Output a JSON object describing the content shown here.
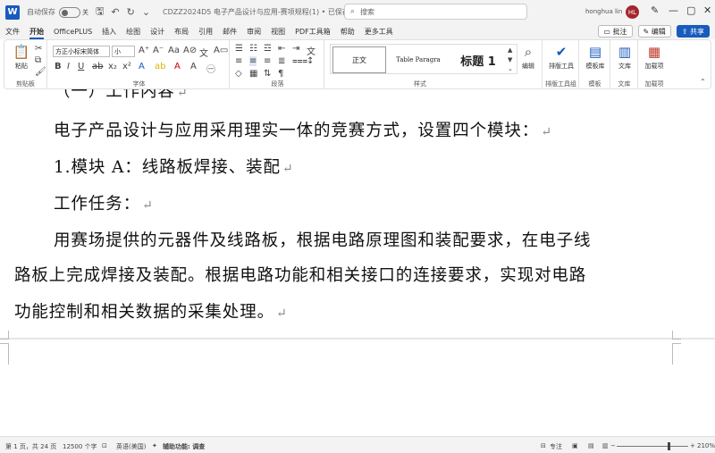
{
  "titlebar": {
    "app_icon": "W",
    "autosave_label": "自动保存",
    "autosave_state": "关",
    "doc_title": "CDZZ2024D5 电子产品设计与应用-赛项规程(1) • 已保存",
    "search_placeholder": "搜索",
    "user_name": "honghua lin",
    "user_initials": "HL"
  },
  "menu": {
    "tabs": [
      "文件",
      "开始",
      "OfficePLUS",
      "插入",
      "绘图",
      "设计",
      "布局",
      "引用",
      "邮件",
      "审阅",
      "视图",
      "PDF工具箱",
      "帮助",
      "更多工具"
    ],
    "active_index": 1,
    "comment_btn": "批注",
    "edit_btn": "编辑",
    "share_btn": "共享"
  },
  "ribbon": {
    "clipboard": {
      "label": "剪贴板",
      "paste": "粘贴"
    },
    "font": {
      "label": "字体",
      "font_name": "方正小标宋简体",
      "font_size": "小"
    },
    "paragraph": {
      "label": "段落"
    },
    "styles": {
      "label": "样式",
      "items": [
        "正文",
        "Table Paragra",
        "标题 1"
      ]
    },
    "editing": {
      "find": "编辑"
    },
    "sort": {
      "label": "排版工具组",
      "tool": "排版工具"
    },
    "template": {
      "label": "模板",
      "item": "模板库"
    },
    "library": {
      "label": "文库",
      "item": "文库"
    },
    "addin": {
      "label": "加载项",
      "item": "加载项"
    }
  },
  "document": {
    "lines": [
      "（一）工作内容",
      "电子产品设计与应用采用理实一体的竞赛方式，设置四个模块：",
      "1.模块 A：线路板焊接、装配",
      "工作任务：",
      "用赛场提供的元器件及线路板，根据电路原理图和装配要求，在电子线",
      "路板上完成焊接及装配。根据电路功能和相关接口的连接要求，实现对电路",
      "功能控制和相关数据的采集处理。"
    ],
    "para_mark": "↵"
  },
  "statusbar": {
    "page": "第 1 页，共 24 页",
    "words": "12500 个字",
    "language": "英语(美国)",
    "accessibility": "辅助功能: 调查",
    "focus": "专注",
    "zoom": "210%",
    "zoom_level": 0.72
  }
}
